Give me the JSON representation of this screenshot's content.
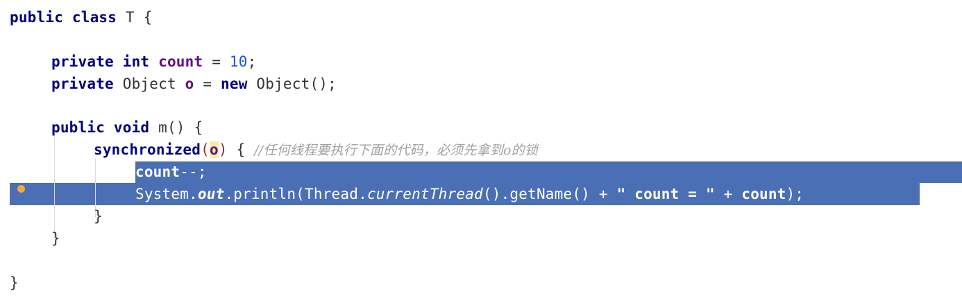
{
  "code": {
    "line1": {
      "kw1": "public",
      "kw2": "class",
      "name": "T",
      "brace": "{"
    },
    "line3": {
      "kw1": "private",
      "kw2": "int",
      "field": "count",
      "op": "=",
      "value": "10",
      "end": ";"
    },
    "line4": {
      "kw1": "private",
      "type": "Object",
      "field": "o",
      "op": "=",
      "kw2": "new",
      "ctor": "Object();"
    },
    "line6": {
      "kw1": "public",
      "kw2": "void",
      "sig": "m()",
      "brace": "{"
    },
    "line7": {
      "kw": "synchronized",
      "open": "(",
      "arg": "o",
      "close": ")",
      "brace": "{",
      "comment": "//任何线程要执行下面的代码，必须先拿到o的锁"
    },
    "line8": {
      "field": "count",
      "rest": "--;"
    },
    "line9": {
      "p1": "System.",
      "out": "out",
      "p2": ".println(Thread.",
      "ct": "currentThread",
      "p3": "().getName() + ",
      "str": "\" count = \"",
      "p4": " + ",
      "field": "count",
      "p5": ");"
    },
    "line10": {
      "brace": "}"
    },
    "line11": {
      "brace": "}"
    },
    "line13": {
      "brace": "}"
    }
  },
  "colors": {
    "selection": "#4a6fb5",
    "keyword": "#00007a",
    "field": "#660e7a",
    "number": "#1750eb",
    "comment": "#a0a0a0",
    "breakpoint": "#f2a93b"
  }
}
